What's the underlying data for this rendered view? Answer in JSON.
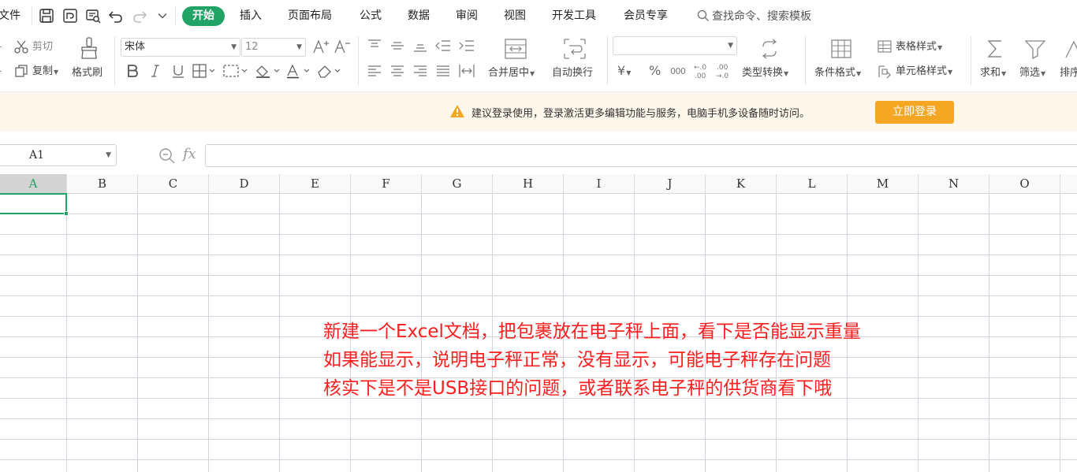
{
  "menubar": {
    "file": "文件",
    "tabs": [
      "开始",
      "插入",
      "页面布局",
      "公式",
      "数据",
      "审阅",
      "视图",
      "开发工具",
      "会员专享"
    ],
    "active_tab": "开始",
    "search_placeholder": "查找命令、搜索模板",
    "quick_icons": [
      "save-icon",
      "export-icon",
      "print-preview-icon",
      "undo-icon",
      "redo-icon",
      "more-down-icon"
    ]
  },
  "ribbon": {
    "clipboard": {
      "cut": "剪切",
      "copy": "复制",
      "format_painter": "格式刷"
    },
    "font": {
      "name": "宋体",
      "size": "12"
    },
    "alignment": {
      "merge_center": "合并居中",
      "auto_wrap": "自动换行"
    },
    "number": {
      "format_value": "",
      "currency": "¥",
      "percent": "%",
      "thousands": "000",
      "inc_decimal": "+.0\n.00",
      "dec_decimal": ".00\n→.0",
      "type_convert": "类型转换"
    },
    "styles": {
      "conditional_format": "条件格式",
      "table_style": "表格样式",
      "cell_style": "单元格样式"
    },
    "editing": {
      "sum": "求和",
      "filter": "筛选",
      "sort": "排序"
    }
  },
  "notice": {
    "message": "建议登录使用，登录激活更多编辑功能与服务，电脑手机多设备随时访问。",
    "button": "立即登录"
  },
  "formula_bar": {
    "cell_ref": "A1",
    "fx": "fx",
    "content": ""
  },
  "sheet": {
    "columns": [
      "A",
      "B",
      "C",
      "D",
      "E",
      "F",
      "G",
      "H",
      "I",
      "J",
      "K",
      "L",
      "M",
      "N",
      "O"
    ],
    "selected_cell": "A1",
    "accent_color": "#21a366"
  },
  "annotation": {
    "color": "#ff1f1f",
    "lines": [
      "新建一个Excel文档，把包裹放在电子秤上面，看下是否能显示重量",
      "如果能显示，说明电子秤正常，没有显示，可能电子秤存在问题",
      "核实下是不是USB接口的问题，或者联系电子秤的供货商看下哦"
    ]
  }
}
